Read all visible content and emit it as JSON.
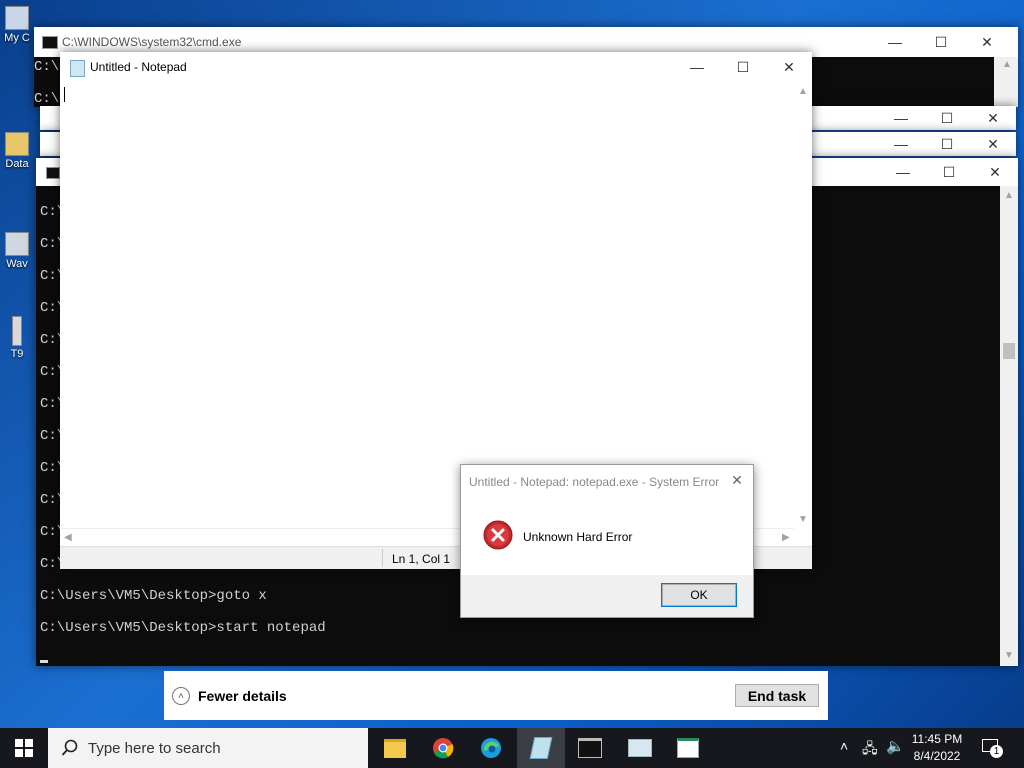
{
  "desktop": {
    "icons": [
      {
        "label": "My C",
        "icon": "computer-icon"
      },
      {
        "label": "Data",
        "icon": "folder-shortcut-icon"
      },
      {
        "label": "Wav",
        "icon": "audio-file-icon"
      },
      {
        "label": "T9",
        "icon": "file-icon"
      }
    ]
  },
  "cmd_back": {
    "title": "C:\\WINDOWS\\system32\\cmd.exe",
    "lines_left": [
      "C:\\",
      "C:\\"
    ]
  },
  "cmd_front": {
    "prompt_stub": "C:\\",
    "lines": [
      "C:\\Users\\VM5\\Desktop>goto x",
      "C:\\Users\\VM5\\Desktop>start notepad"
    ]
  },
  "notepad": {
    "title": "Untitled - Notepad",
    "status": "Ln 1, Col 1"
  },
  "error_dialog": {
    "title": "Untitled - Notepad: notepad.exe - System Error",
    "message": "Unknown Hard Error",
    "ok_label": "OK"
  },
  "task_manager": {
    "fewer_details": "Fewer details",
    "end_task": "End task"
  },
  "taskbar": {
    "search_placeholder": "Type here to search",
    "apps": [
      "file-explorer-icon",
      "chrome-icon",
      "edge-icon",
      "notepad-icon",
      "cmd-icon",
      "task-manager-icon",
      "app-window-icon"
    ],
    "time": "11:45 PM",
    "date": "8/4/2022",
    "notification_count": "1"
  },
  "colors": {
    "desktop_blue": "#1b6fd1",
    "error_red": "#c4262b",
    "focus_blue": "#0078d7"
  }
}
